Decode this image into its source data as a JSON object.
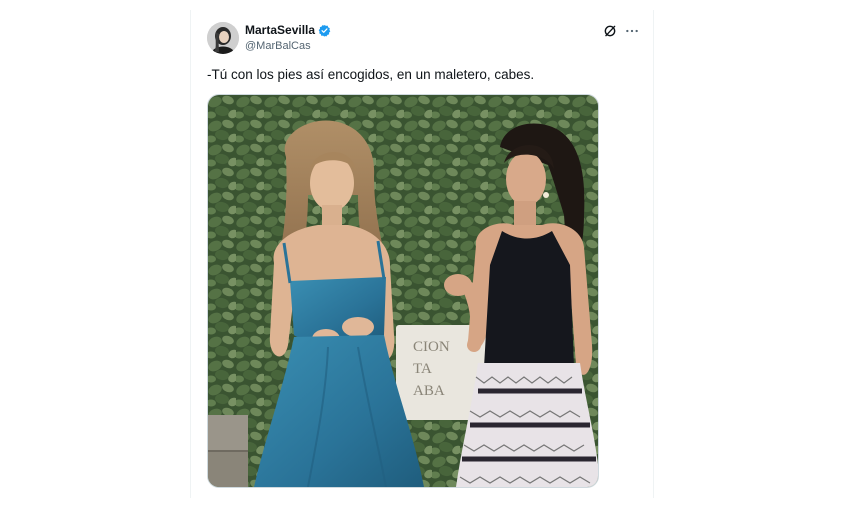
{
  "tweet": {
    "author": {
      "display_name": "MartaSevilla",
      "handle": "@MarBalCas",
      "verified": true
    },
    "text": "-Tú con los pies así encogidos, en un maletero, cabes.",
    "media": {
      "sign_text": [
        "CION",
        "TA",
        "ABA"
      ]
    },
    "icons": {
      "grok": "grok-icon",
      "more": "more-icon",
      "verified": "verified-badge-icon"
    }
  },
  "colors": {
    "accent": "#1d9bf0",
    "text_primary": "#0f1419",
    "text_secondary": "#536471"
  }
}
